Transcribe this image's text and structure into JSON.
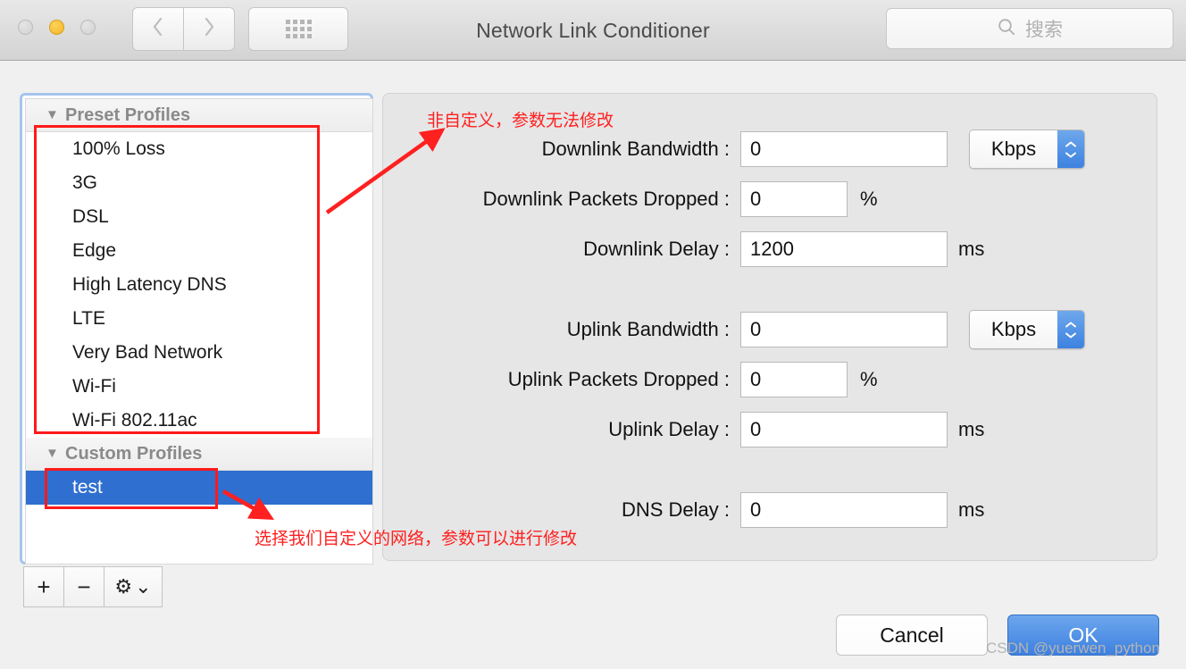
{
  "window": {
    "title": "Network Link Conditioner",
    "traffic_lights": [
      "close",
      "minimize",
      "zoom"
    ],
    "nav": {
      "back_icon": "chevron-left-icon",
      "forward_icon": "chevron-right-icon",
      "grid_icon": "grid-dots-icon"
    },
    "search": {
      "placeholder": "搜索",
      "icon": "search-icon"
    }
  },
  "sidebar": {
    "preset_group": {
      "label": "Preset Profiles",
      "disclosure": "▼"
    },
    "preset_items": [
      {
        "label": "100% Loss"
      },
      {
        "label": "3G"
      },
      {
        "label": "DSL"
      },
      {
        "label": "Edge"
      },
      {
        "label": "High Latency DNS"
      },
      {
        "label": "LTE"
      },
      {
        "label": "Very Bad Network"
      },
      {
        "label": "Wi-Fi"
      },
      {
        "label": "Wi-Fi 802.11ac"
      }
    ],
    "custom_group": {
      "label": "Custom Profiles",
      "disclosure": "▼"
    },
    "custom_items": [
      {
        "label": "test",
        "selected": true
      }
    ],
    "toolbar": [
      {
        "name": "add",
        "glyph": "+"
      },
      {
        "name": "remove",
        "glyph": "−"
      },
      {
        "name": "action",
        "glyph": "⚙",
        "chevron": "⌄"
      }
    ]
  },
  "panel": {
    "fields": [
      {
        "label": "Downlink Bandwidth :",
        "value": "0",
        "unit": "",
        "popup": "Kbps"
      },
      {
        "label": "Downlink Packets Dropped :",
        "value": "0",
        "unit": "%"
      },
      {
        "label": "Downlink Delay :",
        "value": "1200",
        "unit": "ms"
      },
      {
        "label": "Uplink Bandwidth :",
        "value": "0",
        "unit": "",
        "popup": "Kbps"
      },
      {
        "label": "Uplink Packets Dropped :",
        "value": "0",
        "unit": "%"
      },
      {
        "label": "Uplink Delay :",
        "value": "0",
        "unit": "ms"
      },
      {
        "label": "DNS Delay :",
        "value": "0",
        "unit": "ms"
      }
    ]
  },
  "buttons": {
    "cancel": "Cancel",
    "ok": "OK"
  },
  "annotations": {
    "top_note": "非自定义，参数无法修改",
    "bottom_note": "选择我们自定义的网络，参数可以进行修改",
    "accent_color": "#ff2020"
  },
  "watermark": "CSDN @yuerwen_python"
}
